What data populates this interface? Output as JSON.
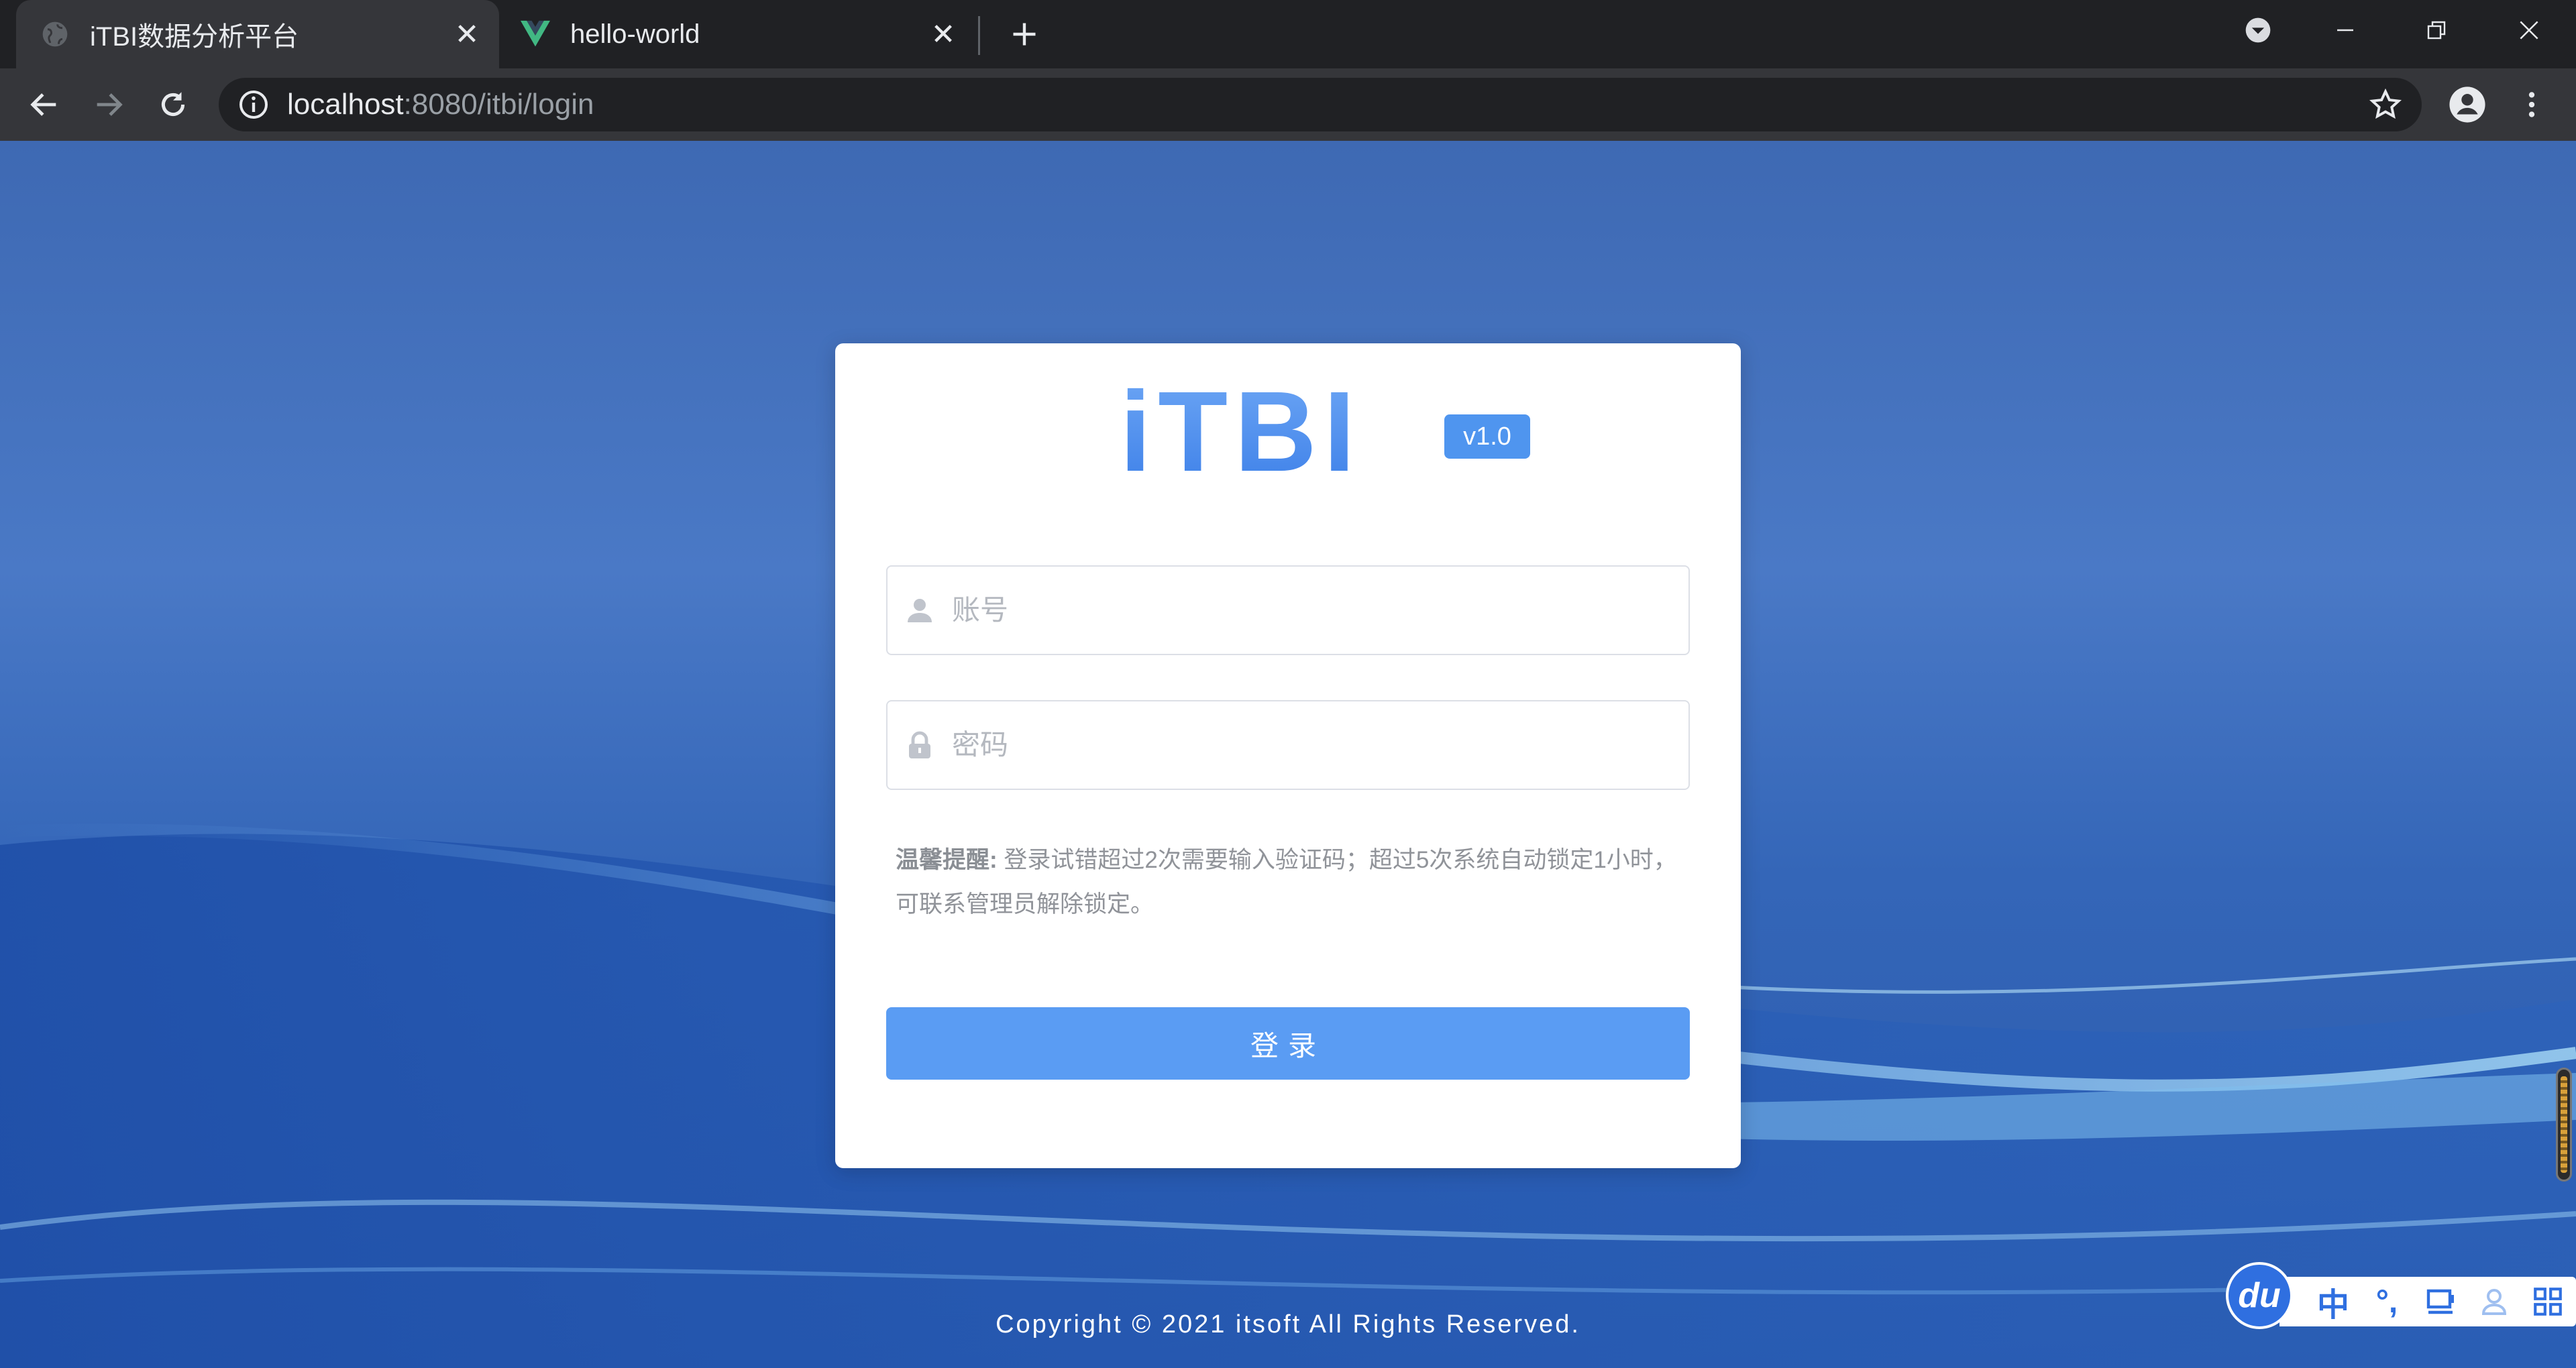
{
  "browser": {
    "tabs": [
      {
        "title": "iTBI数据分析平台",
        "active": true
      },
      {
        "title": "hello-world",
        "active": false
      }
    ],
    "close_glyph": "✕",
    "new_tab_glyph": "+",
    "url": {
      "host": "localhost",
      "rest": ":8080/itbi/login"
    }
  },
  "login": {
    "logo_text": "iTBI",
    "version": "v1.0",
    "account_placeholder": "账号",
    "password_placeholder": "密码",
    "tip_label": "温馨提醒:",
    "tip_text": " 登录试错超过2次需要输入验证码；超过5次系统自动锁定1小时，可联系管理员解除锁定。",
    "button_label": "登录"
  },
  "footer": {
    "copyright": "Copyright © 2021 itsoft All Rights Reserved."
  },
  "ime": {
    "logo": "du",
    "items": [
      "中",
      "°,"
    ]
  },
  "colors": {
    "accent": "#5a9cf3",
    "version_badge": "#4f95ef",
    "chrome_dark": "#202124",
    "chrome_mid": "#35363a"
  }
}
